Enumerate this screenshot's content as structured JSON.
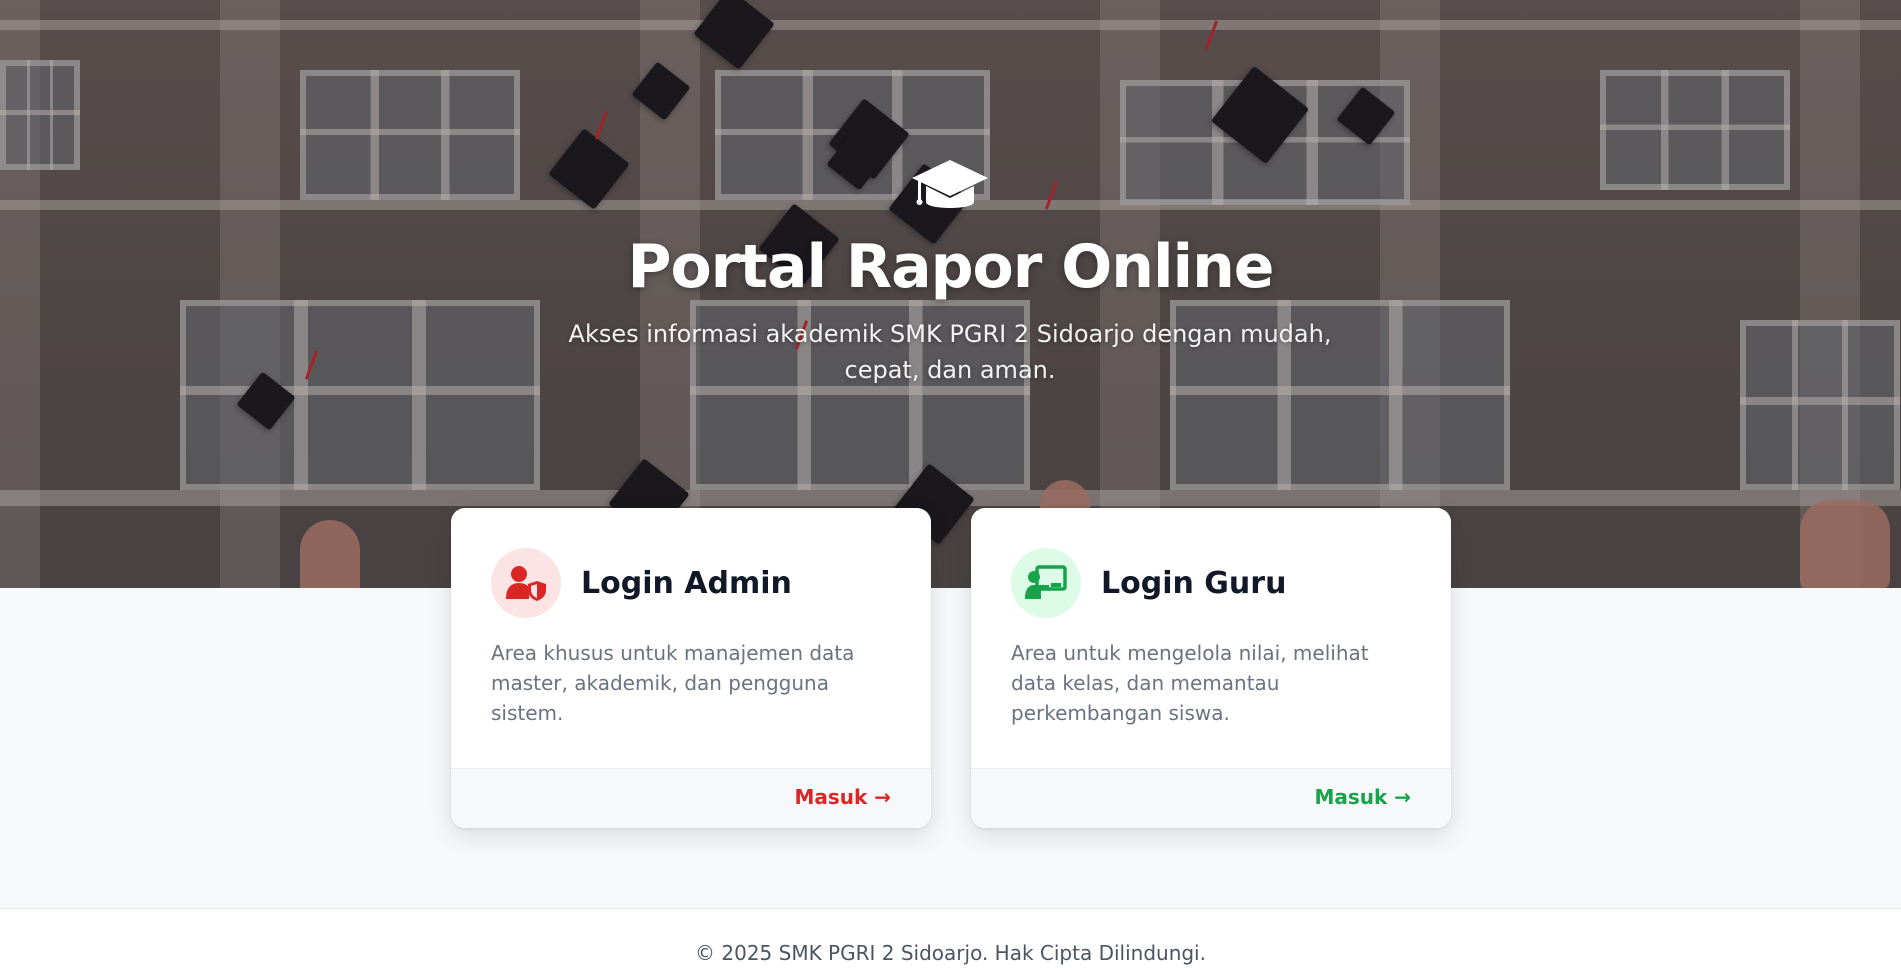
{
  "hero": {
    "icon": "graduation-cap-icon",
    "title": "Portal Rapor Online",
    "subtitle_line1": "Akses informasi akademik SMK PGRI 2 Sidoarjo dengan mudah,",
    "subtitle_line2": "cepat, dan aman."
  },
  "cards": {
    "admin": {
      "icon": "user-shield-icon",
      "title": "Login Admin",
      "description": "Area khusus untuk manajemen data master, akademik, dan pengguna sistem.",
      "link_label": "Masuk →",
      "accent": "#dc2626",
      "icon_bg": "#fde4e4"
    },
    "guru": {
      "icon": "chalkboard-teacher-icon",
      "title": "Login Guru",
      "description": "Area untuk mengelola nilai, melihat data kelas, dan memantau perkembangan siswa.",
      "link_label": "Masuk →",
      "accent": "#16a34a",
      "icon_bg": "#dcfce7"
    }
  },
  "footer": {
    "copyright": "© 2025 SMK PGRI 2 Sidoarjo. Hak Cipta Dilindungi."
  }
}
